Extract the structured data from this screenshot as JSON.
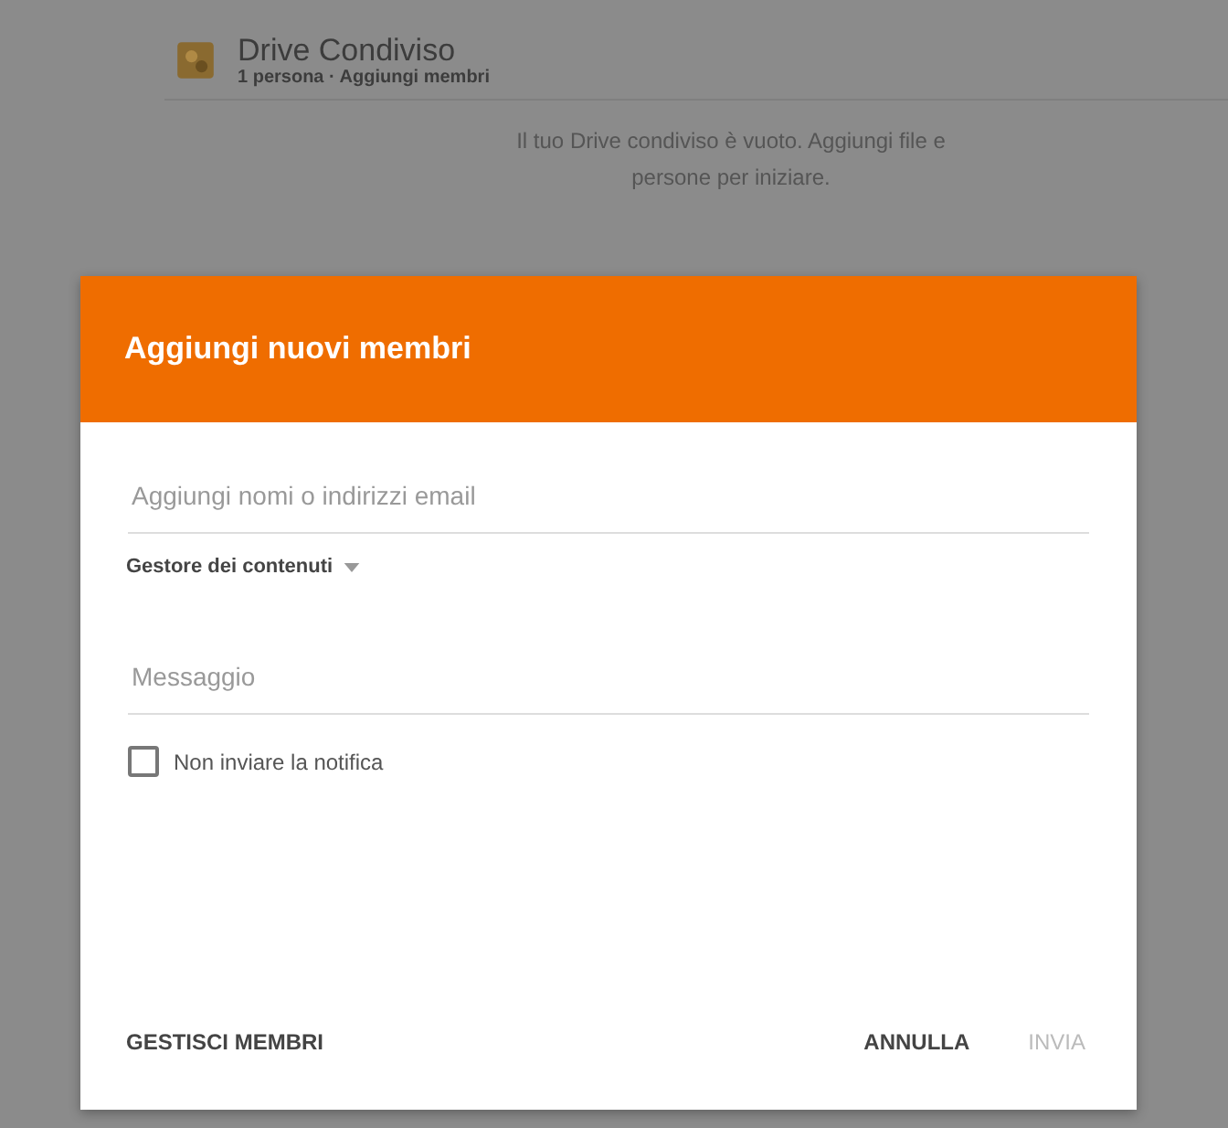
{
  "background": {
    "drive_title": "Drive Condiviso",
    "drive_subtitle": "1 persona · Aggiungi membri",
    "empty_message": "Il tuo Drive condiviso è vuoto. Aggiungi file e persone per iniziare."
  },
  "dialog": {
    "title": "Aggiungi nuovi membri",
    "people_field": {
      "placeholder": "Aggiungi nomi o indirizzi email"
    },
    "role_dropdown": {
      "value": "Gestore dei contenuti"
    },
    "message_field": {
      "placeholder": "Messaggio"
    },
    "notify_checkbox": {
      "label": "Non inviare la notifica",
      "checked": false
    },
    "buttons": [
      {
        "label": "GESTISCI MEMBRI",
        "disabled": false
      },
      {
        "label": "ANNULLA",
        "disabled": false
      },
      {
        "label": "INVIA",
        "disabled": true
      }
    ]
  }
}
